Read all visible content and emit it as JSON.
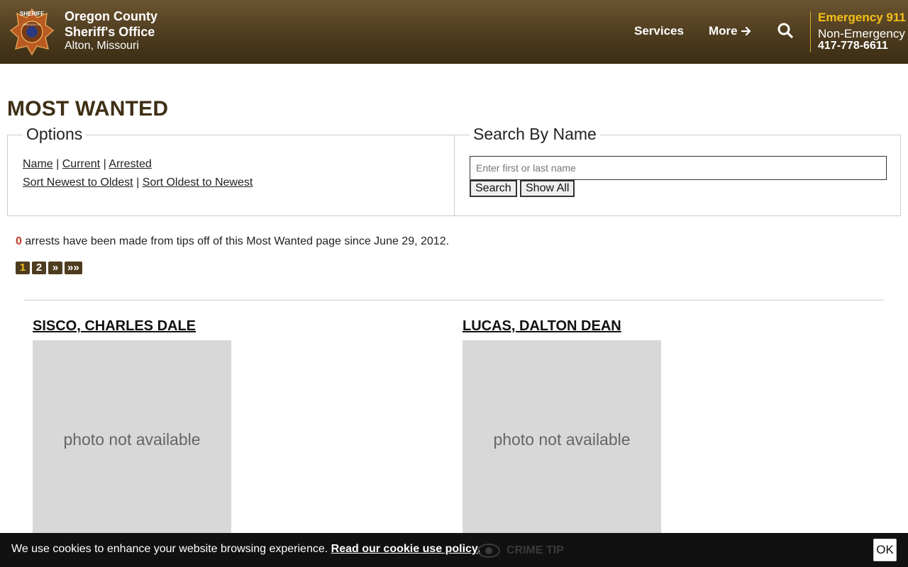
{
  "header": {
    "title_line1": "Oregon County",
    "title_line2": "Sheriff's Office",
    "location": "Alton, Missouri",
    "nav_services": "Services",
    "nav_more": "More",
    "emergency": "Emergency 911",
    "non_emergency": "Non-Emergency",
    "phone": "417-778-6611",
    "badge_top": "SHERIFF",
    "badge_mid": "OREGON CO."
  },
  "page_title": "MOST WANTED",
  "options": {
    "legend": "Options",
    "links_row1": [
      "Name",
      "Current",
      "Arrested"
    ],
    "links_row2": [
      "Sort Newest to Oldest",
      "Sort Oldest to Newest"
    ],
    "sep": "|"
  },
  "search": {
    "legend": "Search By Name",
    "placeholder": "Enter first or last name",
    "search_btn": "Search",
    "show_all_btn": "Show All"
  },
  "arrests": {
    "count": "0",
    "text": "arrests have been made from tips off of this Most Wanted page since June 29, 2012."
  },
  "pager": [
    "1",
    "2",
    "»",
    "»»"
  ],
  "wanted": [
    {
      "name": "SISCO, CHARLES DALE",
      "photo_text": "photo not available"
    },
    {
      "name": "LUCAS, DALTON DEAN",
      "photo_text": "photo not available"
    }
  ],
  "cookie": {
    "text": "We use cookies to enhance your website browsing experience.",
    "link": "Read our cookie use policy.",
    "ok": "OK",
    "crime_tip": "CRIME TIP"
  },
  "colors": {
    "header_brown": "#4e3c1f",
    "emergency_yellow": "#f5c016",
    "title_brown": "#3f2f15",
    "count_red": "#c0392b"
  }
}
